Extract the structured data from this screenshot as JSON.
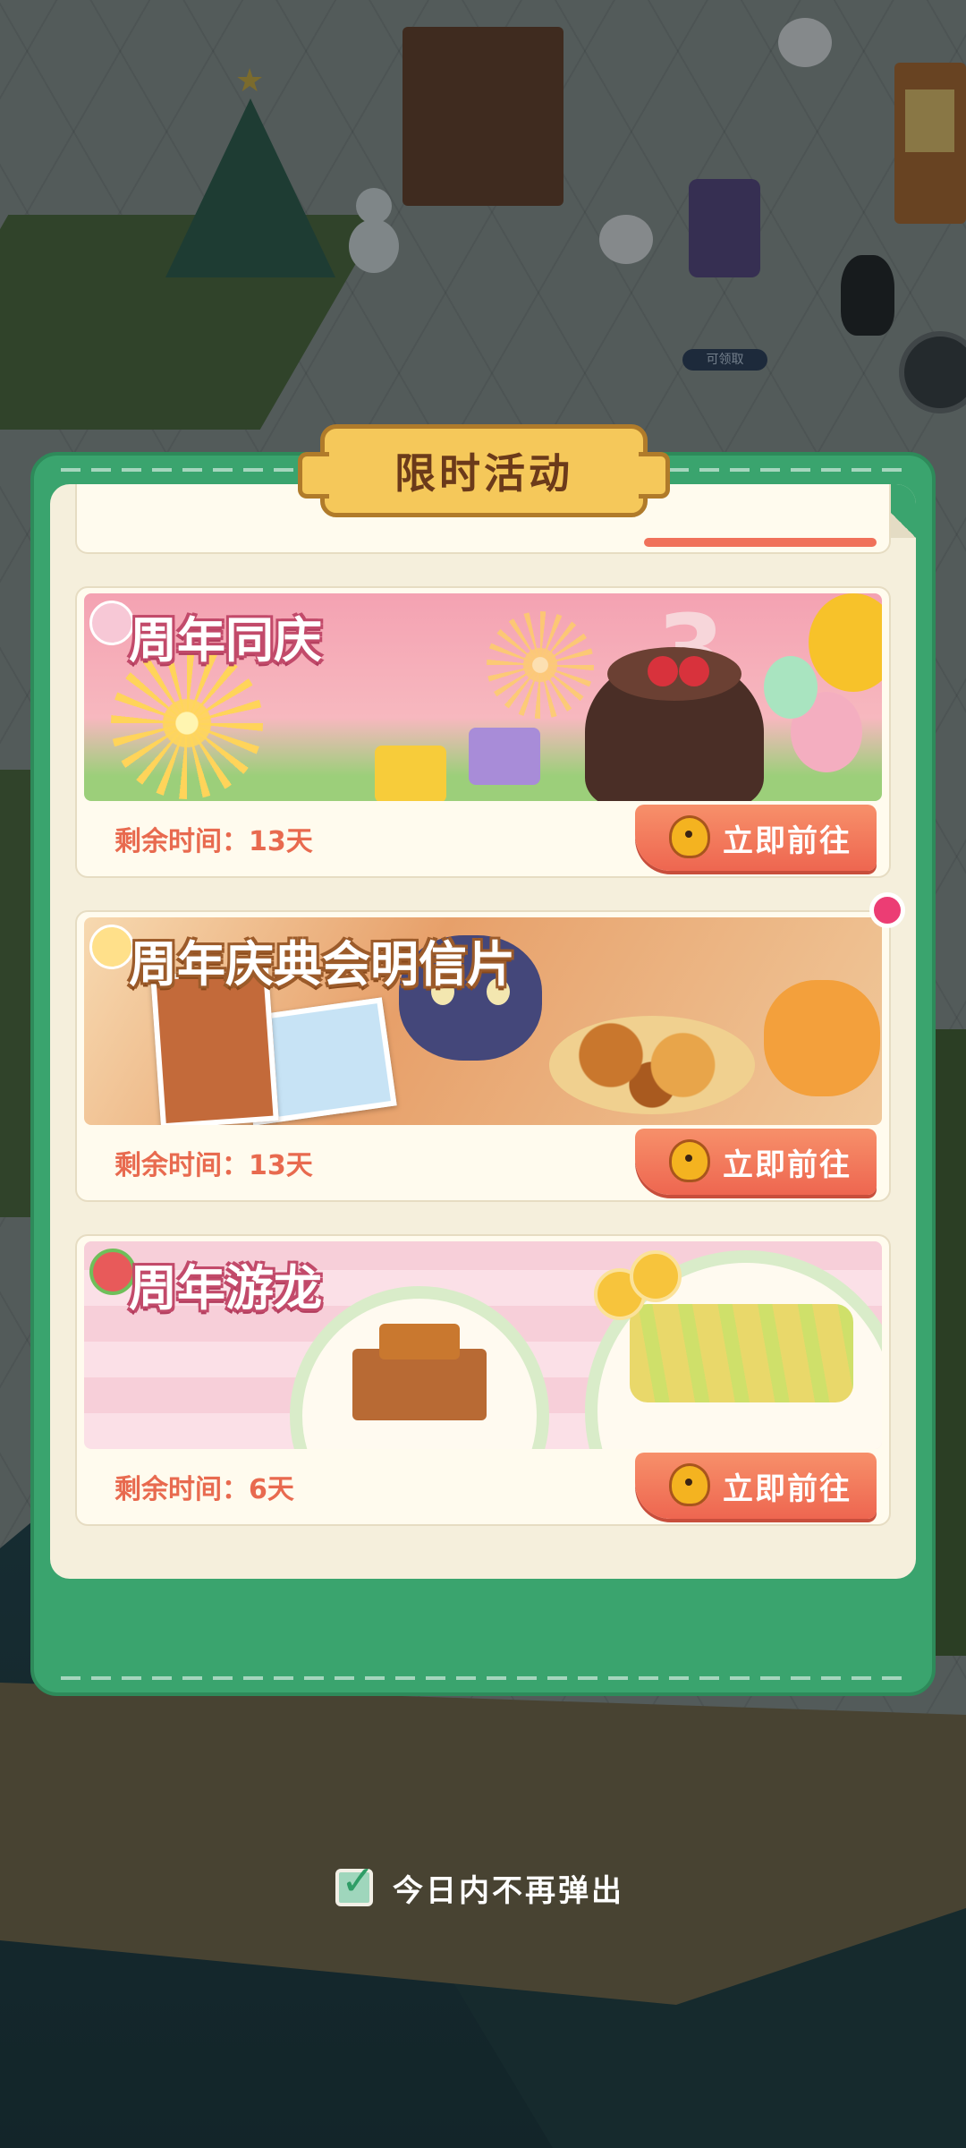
{
  "scene": {
    "claim_tag": "可领取"
  },
  "dialog": {
    "title": "限时活动",
    "events": [
      {
        "title": "周年同庆",
        "banner_number": "3",
        "remaining_label": "剩余时间：13天",
        "button_label": "立即前往",
        "has_new_dot": false
      },
      {
        "title": "周年庆典会明信片",
        "remaining_label": "剩余时间：13天",
        "button_label": "立即前往",
        "has_new_dot": true
      },
      {
        "title": "周年游龙",
        "remaining_label": "剩余时间：6天",
        "button_label": "立即前往",
        "has_new_dot": false
      }
    ]
  },
  "footer": {
    "dont_show_today_label": "今日内不再弹出",
    "dont_show_today_checked": true
  },
  "colors": {
    "dialog_green": "#3aa46e",
    "button_coral": "#ee6650",
    "timer_text": "#e86a4f",
    "title_gold": "#f5c85a"
  }
}
